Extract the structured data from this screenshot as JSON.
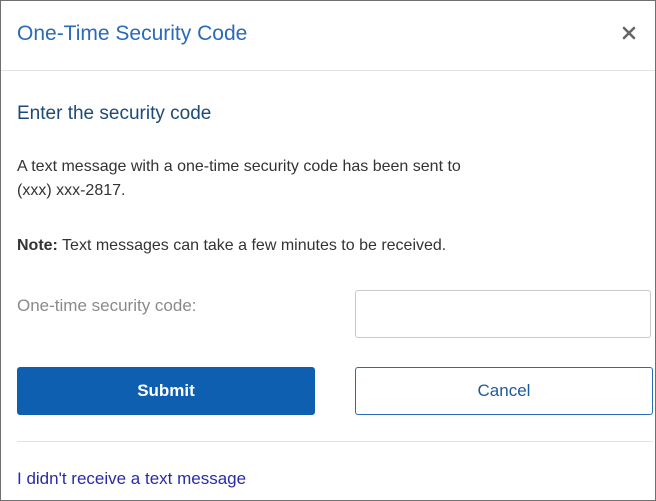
{
  "dialog": {
    "title": "One-Time Security Code",
    "close_icon": "close-icon"
  },
  "content": {
    "subtitle": "Enter the security code",
    "message_line1": "A text message with a one-time security code has been sent to",
    "message_line2": "(xxx) xxx-2817.",
    "note_label": "Note:",
    "note_text": " Text messages can take a few minutes to be received.",
    "code_label": "One-time security code:",
    "code_value": "",
    "code_placeholder": ""
  },
  "buttons": {
    "submit_label": "Submit",
    "cancel_label": "Cancel"
  },
  "footer": {
    "link_text": "I didn't receive a text message"
  },
  "colors": {
    "title": "#2a6ab8",
    "primary": "#0f5fb0",
    "link": "#2a2aa8"
  }
}
